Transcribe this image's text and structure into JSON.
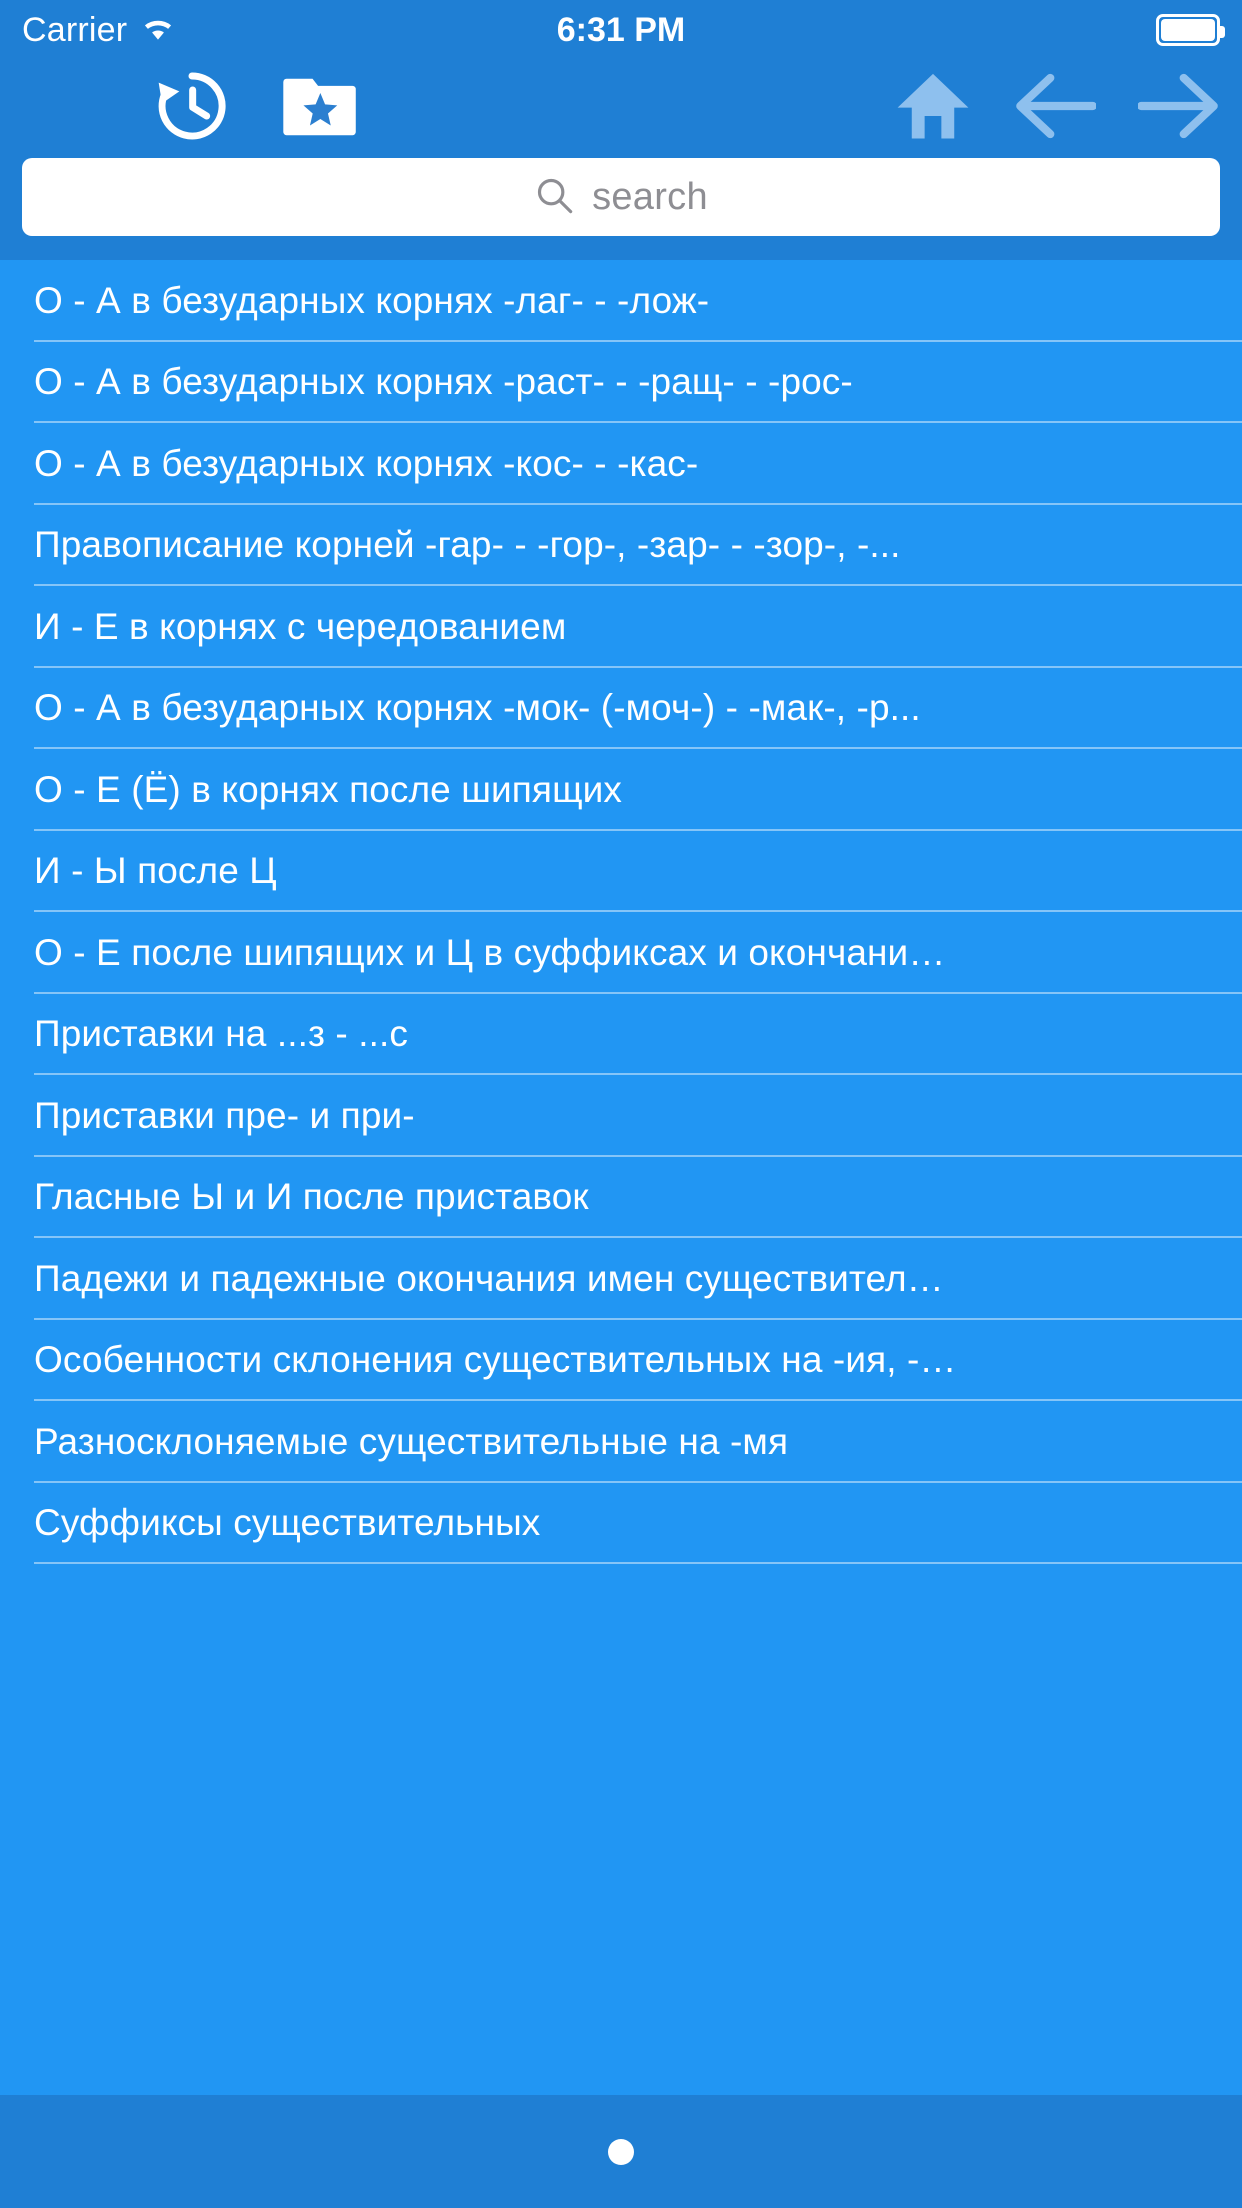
{
  "status_bar": {
    "carrier": "Carrier",
    "wifi_icon": "wifi-icon",
    "time": "6:31 PM",
    "battery_icon": "battery-icon"
  },
  "toolbar": {
    "menu_icon": "hamburger-menu-icon",
    "history_icon": "history-clock-icon",
    "favorites_icon": "folder-star-icon",
    "home_icon": "home-icon",
    "back_icon": "arrow-left-icon",
    "forward_icon": "arrow-right-icon"
  },
  "search": {
    "placeholder": "search",
    "value": "",
    "icon": "search-icon"
  },
  "colors": {
    "header": "#1f7fd4",
    "list_background": "#2196f3",
    "text": "#ffffff",
    "separator": "rgba(255,255,255,0.45)",
    "nav_icon_inactive": "#8ec0ee",
    "placeholder": "#8e8e93"
  },
  "list": {
    "items": [
      {
        "label": "О - А в безударных корнях -лаг- - -лож-"
      },
      {
        "label": "О - А в безударных корнях -раст- - -ращ- - -рос-"
      },
      {
        "label": "О - А в безударных корнях -кос- - -кас-"
      },
      {
        "label": "Правописание корней -гар- - -гор-, -зар- - -зор-, -..."
      },
      {
        "label": "И - Е в корнях с чередованием"
      },
      {
        "label": "О - А в безударных корнях -мок- (-моч-) - -мак-, -р..."
      },
      {
        "label": "О - Е (Ё) в корнях после шипящих"
      },
      {
        "label": "И - Ы после Ц"
      },
      {
        "label": "О - Е после шипящих и Ц в суффиксах и окончани…"
      },
      {
        "label": "Приставки на ...з - ...с"
      },
      {
        "label": "Приставки пре- и при-"
      },
      {
        "label": "Гласные Ы и И после приставок"
      },
      {
        "label": "Падежи и падежные окончания имен существител…"
      },
      {
        "label": "Особенности склонения существительных на -ия, -…"
      },
      {
        "label": "Разносклоняемые существительные на -мя"
      },
      {
        "label": "Суффиксы существительных"
      }
    ]
  },
  "footer": {
    "home_indicator": "home-indicator-dot"
  }
}
